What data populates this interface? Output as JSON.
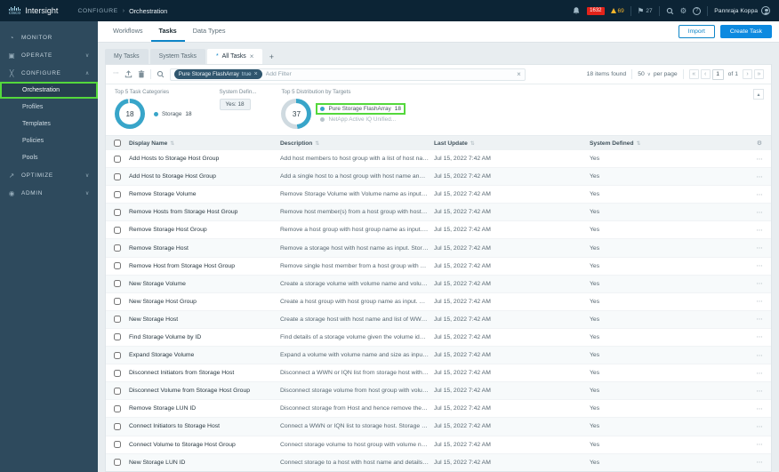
{
  "colors": {
    "accent_blue": "#0d85c8",
    "primary_button_blue": "#0d8ae0",
    "annotation_green": "#54d83c",
    "critical_red": "#e2231a",
    "warning_amber": "#f7b52b",
    "donut_teal": "#38a5c9",
    "topbar_bg": "#0c2435",
    "sidebar_bg": "#2e4a5d"
  },
  "icons": {
    "breadcrumb_separator": "›",
    "gear": "⚙",
    "help": "?",
    "requests": "⚑",
    "monitor": "◔",
    "operate": "▣",
    "configure": "╳",
    "optimize": "↗",
    "admin": "◉",
    "chevron_down": "∨",
    "chevron_up": "∧",
    "close": "×",
    "plus": "+",
    "more": "⋯",
    "ellipsis": "⋯",
    "sort": "⇅",
    "dropdown": "∨",
    "first": "«",
    "prev": "‹",
    "next": "›",
    "last": "»",
    "collapse": "▴"
  },
  "topbar": {
    "logo_text": "cisco",
    "brand": "Intersight",
    "breadcrumb_section": "CONFIGURE",
    "breadcrumb_page": "Orchestration",
    "critical_count": "1632",
    "warning_count": "69",
    "request_count": "27",
    "user_name": "Pannraja Koppa"
  },
  "sidebar": {
    "items": [
      {
        "label": "MONITOR"
      },
      {
        "label": "OPERATE"
      },
      {
        "label": "CONFIGURE"
      },
      {
        "label": "OPTIMIZE"
      },
      {
        "label": "ADMIN"
      }
    ],
    "configure_children": [
      "Orchestration",
      "Profiles",
      "Templates",
      "Policies",
      "Pools"
    ],
    "active_child": "Orchestration"
  },
  "page_header": {
    "tabs": [
      "Workflows",
      "Tasks",
      "Data Types"
    ],
    "active_tab": "Tasks",
    "import_label": "Import",
    "create_label": "Create Task"
  },
  "task_tabs": {
    "my": "My Tasks",
    "system": "System Tasks",
    "active_label": "All Tasks",
    "dirty": "*"
  },
  "toolbar": {
    "chip_name": "Pure Storage FlashArray",
    "chip_value": "true",
    "filter_placeholder": "Add Filter",
    "items_found": "18 items found",
    "per_page": "50",
    "per_page_label": "per page",
    "page_current": "1",
    "page_info": "of 1"
  },
  "widgets": {
    "categories_title": "Top 5 Task Categories",
    "categories_total": "18",
    "categories_legend_label": "Storage",
    "categories_legend_value": "18",
    "system_defined_title": "System Defin...",
    "system_defined_tag": "Yes: 18",
    "targets_title": "Top 5 Distribution by Targets",
    "targets_total": "37",
    "targets_legend_0_label": "Pure Storage FlashArray",
    "targets_legend_0_value": "18",
    "targets_legend_1_label": "NetApp Active IQ Unified..."
  },
  "table": {
    "columns": [
      "Display Name",
      "Description",
      "Last Update",
      "System Defined"
    ],
    "rows": [
      {
        "name": "Add Hosts to Storage Host Group",
        "description": "Add host members to host group with a list of host names, an...",
        "updated": "Jul 15, 2022 7:42 AM",
        "system": "Yes"
      },
      {
        "name": "Add Host to Storage Host Group",
        "description": "Add a single host to a host group with host name and host gr...",
        "updated": "Jul 15, 2022 7:42 AM",
        "system": "Yes"
      },
      {
        "name": "Remove Storage Volume",
        "description": "Remove Storage Volume with Volume name as input. On succe...",
        "updated": "Jul 15, 2022 7:42 AM",
        "system": "Yes"
      },
      {
        "name": "Remove Hosts from Storage Host Group",
        "description": "Remove host member(s) from a host group with host name(s)...",
        "updated": "Jul 15, 2022 7:42 AM",
        "system": "Yes"
      },
      {
        "name": "Remove Storage Host Group",
        "description": "Remove a host group with host group name as input. On succ...",
        "updated": "Jul 15, 2022 7:42 AM",
        "system": "Yes"
      },
      {
        "name": "Remove Storage Host",
        "description": "Remove a storage host with host name as input. Storage host ...",
        "updated": "Jul 15, 2022 7:42 AM",
        "system": "Yes"
      },
      {
        "name": "Remove Host from Storage Host Group",
        "description": "Remove single host member from a host group with host nam...",
        "updated": "Jul 15, 2022 7:42 AM",
        "system": "Yes"
      },
      {
        "name": "New Storage Volume",
        "description": "Create a storage volume with volume name and volume size a...",
        "updated": "Jul 15, 2022 7:42 AM",
        "system": "Yes"
      },
      {
        "name": "New Storage Host Group",
        "description": "Create a host group with host group name as input. On succe...",
        "updated": "Jul 15, 2022 7:42 AM",
        "system": "Yes"
      },
      {
        "name": "New Storage Host",
        "description": "Create a storage host with host name and list of WWNs and ...",
        "updated": "Jul 15, 2022 7:42 AM",
        "system": "Yes"
      },
      {
        "name": "Find Storage Volume by ID",
        "description": "Find details of a storage volume given the volume identifier lik...",
        "updated": "Jul 15, 2022 7:42 AM",
        "system": "Yes"
      },
      {
        "name": "Expand Storage Volume",
        "description": "Expand a volume with volume name and size as inputs. On su...",
        "updated": "Jul 15, 2022 7:42 AM",
        "system": "Yes"
      },
      {
        "name": "Disconnect Initiators from Storage Host",
        "description": "Disconnect a WWN or IQN list from storage host with host na...",
        "updated": "Jul 15, 2022 7:42 AM",
        "system": "Yes"
      },
      {
        "name": "Disconnect Volume from Storage Host Group",
        "description": "Disconnect storage volume from host group with volume nam...",
        "updated": "Jul 15, 2022 7:42 AM",
        "system": "Yes"
      },
      {
        "name": "Remove Storage LUN ID",
        "description": "Disconnect storage from Host and hence remove the LUN ID ...",
        "updated": "Jul 15, 2022 7:42 AM",
        "system": "Yes"
      },
      {
        "name": "Connect Initiators to Storage Host",
        "description": "Connect a WWN or IQN list to storage host. Storage host is th...",
        "updated": "Jul 15, 2022 7:42 AM",
        "system": "Yes"
      },
      {
        "name": "Connect Volume to Storage Host Group",
        "description": "Connect storage volume to host group with volume name, hos...",
        "updated": "Jul 15, 2022 7:42 AM",
        "system": "Yes"
      },
      {
        "name": "New Storage LUN ID",
        "description": "Connect storage to a host with host name and details needed ...",
        "updated": "Jul 15, 2022 7:42 AM",
        "system": "Yes"
      }
    ]
  }
}
